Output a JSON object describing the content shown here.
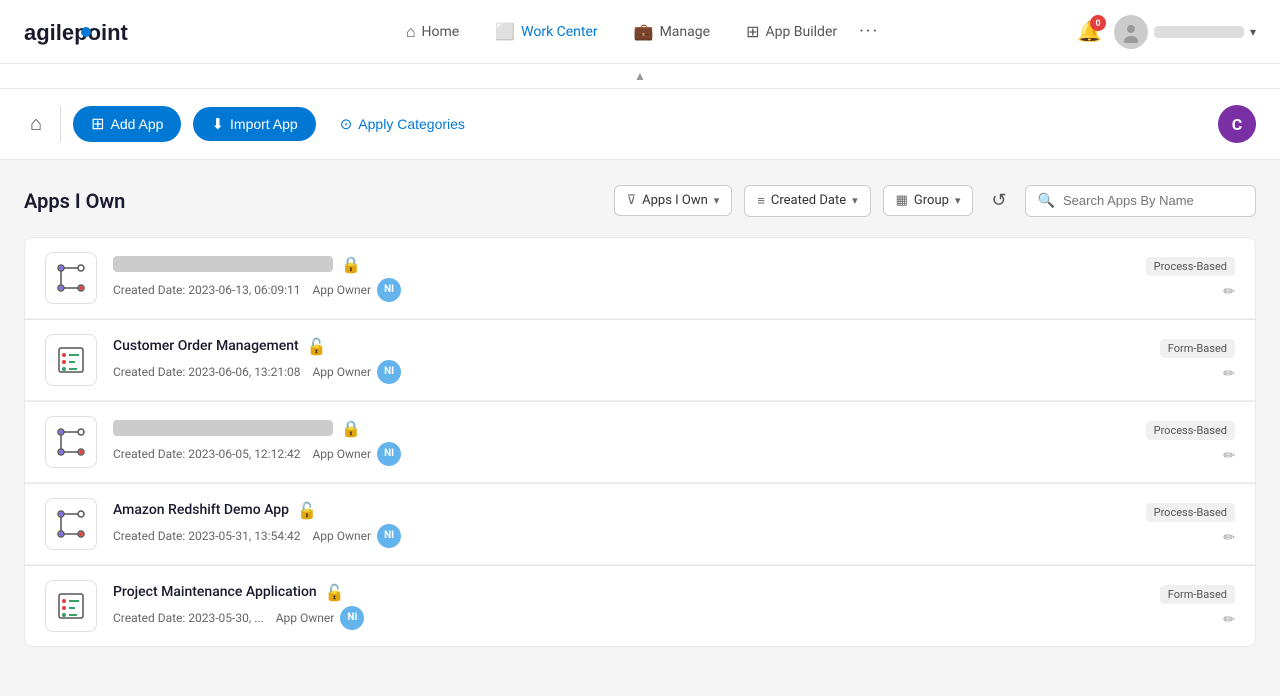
{
  "navbar": {
    "logo_text": "agilepoint",
    "nav_items": [
      {
        "id": "home",
        "label": "Home",
        "icon": "🏠",
        "active": false
      },
      {
        "id": "workcenter",
        "label": "Work Center",
        "icon": "🖥",
        "active": true
      },
      {
        "id": "manage",
        "label": "Manage",
        "icon": "💼",
        "active": false
      },
      {
        "id": "appbuilder",
        "label": "App Builder",
        "icon": "⊞",
        "active": false
      }
    ],
    "bell_count": "0",
    "user_chevron": "▾"
  },
  "toolbar": {
    "add_app_label": "Add App",
    "import_app_label": "Import App",
    "apply_categories_label": "Apply Categories",
    "user_initial": "C"
  },
  "filters": {
    "section_title": "Apps I Own",
    "filter1_label": "Apps I Own",
    "filter2_label": "Created Date",
    "filter3_label": "Group",
    "search_placeholder": "Search Apps By Name"
  },
  "apps": [
    {
      "id": "app1",
      "name_blurred": true,
      "name": "████████████████ ██ ████",
      "created": "Created Date: 2023-06-13, 06:09:11",
      "owner_label": "App Owner",
      "owner_initials": "NI",
      "type": "Process-Based",
      "locked": true,
      "icon_type": "process"
    },
    {
      "id": "app2",
      "name_blurred": false,
      "name": "Customer Order Management",
      "created": "Created Date: 2023-06-06, 13:21:08",
      "owner_label": "App Owner",
      "owner_initials": "NI",
      "type": "Form-Based",
      "locked": false,
      "icon_type": "form"
    },
    {
      "id": "app3",
      "name_blurred": true,
      "name": "████████████████ ██ ████",
      "created": "Created Date: 2023-06-05, 12:12:42",
      "owner_label": "App Owner",
      "owner_initials": "NI",
      "type": "Process-Based",
      "locked": true,
      "icon_type": "process"
    },
    {
      "id": "app4",
      "name_blurred": false,
      "name": "Amazon Redshift Demo App",
      "created": "Created Date: 2023-05-31, 13:54:42",
      "owner_label": "App Owner",
      "owner_initials": "NI",
      "type": "Process-Based",
      "locked": false,
      "icon_type": "process"
    },
    {
      "id": "app5",
      "name_blurred": false,
      "name": "Project Maintenance Application",
      "created": "Created Date: 2023-05-30, ...",
      "owner_label": "App Owner",
      "owner_initials": "NI",
      "type": "Form-Based",
      "locked": false,
      "icon_type": "form"
    }
  ]
}
